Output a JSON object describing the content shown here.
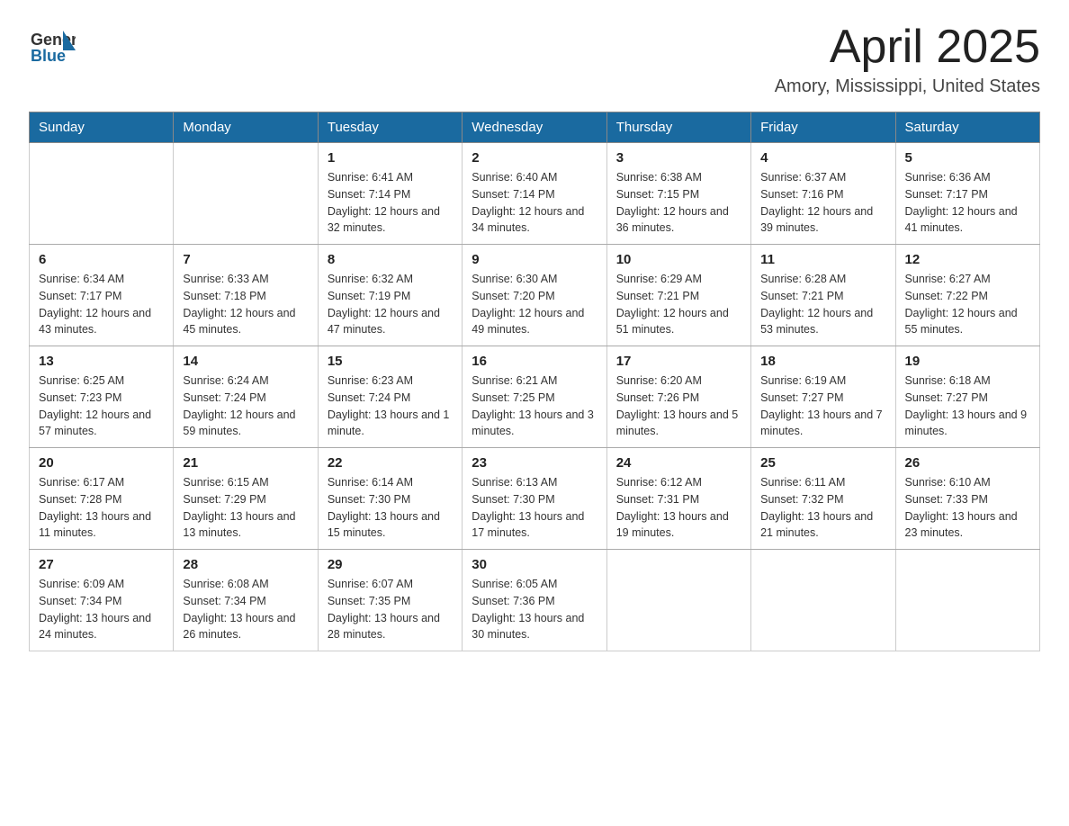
{
  "header": {
    "logo_general": "General",
    "logo_blue": "Blue",
    "title": "April 2025",
    "subtitle": "Amory, Mississippi, United States"
  },
  "columns": [
    "Sunday",
    "Monday",
    "Tuesday",
    "Wednesday",
    "Thursday",
    "Friday",
    "Saturday"
  ],
  "weeks": [
    [
      {
        "day": "",
        "info": ""
      },
      {
        "day": "",
        "info": ""
      },
      {
        "day": "1",
        "info": "Sunrise: 6:41 AM\nSunset: 7:14 PM\nDaylight: 12 hours\nand 32 minutes."
      },
      {
        "day": "2",
        "info": "Sunrise: 6:40 AM\nSunset: 7:14 PM\nDaylight: 12 hours\nand 34 minutes."
      },
      {
        "day": "3",
        "info": "Sunrise: 6:38 AM\nSunset: 7:15 PM\nDaylight: 12 hours\nand 36 minutes."
      },
      {
        "day": "4",
        "info": "Sunrise: 6:37 AM\nSunset: 7:16 PM\nDaylight: 12 hours\nand 39 minutes."
      },
      {
        "day": "5",
        "info": "Sunrise: 6:36 AM\nSunset: 7:17 PM\nDaylight: 12 hours\nand 41 minutes."
      }
    ],
    [
      {
        "day": "6",
        "info": "Sunrise: 6:34 AM\nSunset: 7:17 PM\nDaylight: 12 hours\nand 43 minutes."
      },
      {
        "day": "7",
        "info": "Sunrise: 6:33 AM\nSunset: 7:18 PM\nDaylight: 12 hours\nand 45 minutes."
      },
      {
        "day": "8",
        "info": "Sunrise: 6:32 AM\nSunset: 7:19 PM\nDaylight: 12 hours\nand 47 minutes."
      },
      {
        "day": "9",
        "info": "Sunrise: 6:30 AM\nSunset: 7:20 PM\nDaylight: 12 hours\nand 49 minutes."
      },
      {
        "day": "10",
        "info": "Sunrise: 6:29 AM\nSunset: 7:21 PM\nDaylight: 12 hours\nand 51 minutes."
      },
      {
        "day": "11",
        "info": "Sunrise: 6:28 AM\nSunset: 7:21 PM\nDaylight: 12 hours\nand 53 minutes."
      },
      {
        "day": "12",
        "info": "Sunrise: 6:27 AM\nSunset: 7:22 PM\nDaylight: 12 hours\nand 55 minutes."
      }
    ],
    [
      {
        "day": "13",
        "info": "Sunrise: 6:25 AM\nSunset: 7:23 PM\nDaylight: 12 hours\nand 57 minutes."
      },
      {
        "day": "14",
        "info": "Sunrise: 6:24 AM\nSunset: 7:24 PM\nDaylight: 12 hours\nand 59 minutes."
      },
      {
        "day": "15",
        "info": "Sunrise: 6:23 AM\nSunset: 7:24 PM\nDaylight: 13 hours\nand 1 minute."
      },
      {
        "day": "16",
        "info": "Sunrise: 6:21 AM\nSunset: 7:25 PM\nDaylight: 13 hours\nand 3 minutes."
      },
      {
        "day": "17",
        "info": "Sunrise: 6:20 AM\nSunset: 7:26 PM\nDaylight: 13 hours\nand 5 minutes."
      },
      {
        "day": "18",
        "info": "Sunrise: 6:19 AM\nSunset: 7:27 PM\nDaylight: 13 hours\nand 7 minutes."
      },
      {
        "day": "19",
        "info": "Sunrise: 6:18 AM\nSunset: 7:27 PM\nDaylight: 13 hours\nand 9 minutes."
      }
    ],
    [
      {
        "day": "20",
        "info": "Sunrise: 6:17 AM\nSunset: 7:28 PM\nDaylight: 13 hours\nand 11 minutes."
      },
      {
        "day": "21",
        "info": "Sunrise: 6:15 AM\nSunset: 7:29 PM\nDaylight: 13 hours\nand 13 minutes."
      },
      {
        "day": "22",
        "info": "Sunrise: 6:14 AM\nSunset: 7:30 PM\nDaylight: 13 hours\nand 15 minutes."
      },
      {
        "day": "23",
        "info": "Sunrise: 6:13 AM\nSunset: 7:30 PM\nDaylight: 13 hours\nand 17 minutes."
      },
      {
        "day": "24",
        "info": "Sunrise: 6:12 AM\nSunset: 7:31 PM\nDaylight: 13 hours\nand 19 minutes."
      },
      {
        "day": "25",
        "info": "Sunrise: 6:11 AM\nSunset: 7:32 PM\nDaylight: 13 hours\nand 21 minutes."
      },
      {
        "day": "26",
        "info": "Sunrise: 6:10 AM\nSunset: 7:33 PM\nDaylight: 13 hours\nand 23 minutes."
      }
    ],
    [
      {
        "day": "27",
        "info": "Sunrise: 6:09 AM\nSunset: 7:34 PM\nDaylight: 13 hours\nand 24 minutes."
      },
      {
        "day": "28",
        "info": "Sunrise: 6:08 AM\nSunset: 7:34 PM\nDaylight: 13 hours\nand 26 minutes."
      },
      {
        "day": "29",
        "info": "Sunrise: 6:07 AM\nSunset: 7:35 PM\nDaylight: 13 hours\nand 28 minutes."
      },
      {
        "day": "30",
        "info": "Sunrise: 6:05 AM\nSunset: 7:36 PM\nDaylight: 13 hours\nand 30 minutes."
      },
      {
        "day": "",
        "info": ""
      },
      {
        "day": "",
        "info": ""
      },
      {
        "day": "",
        "info": ""
      }
    ]
  ]
}
